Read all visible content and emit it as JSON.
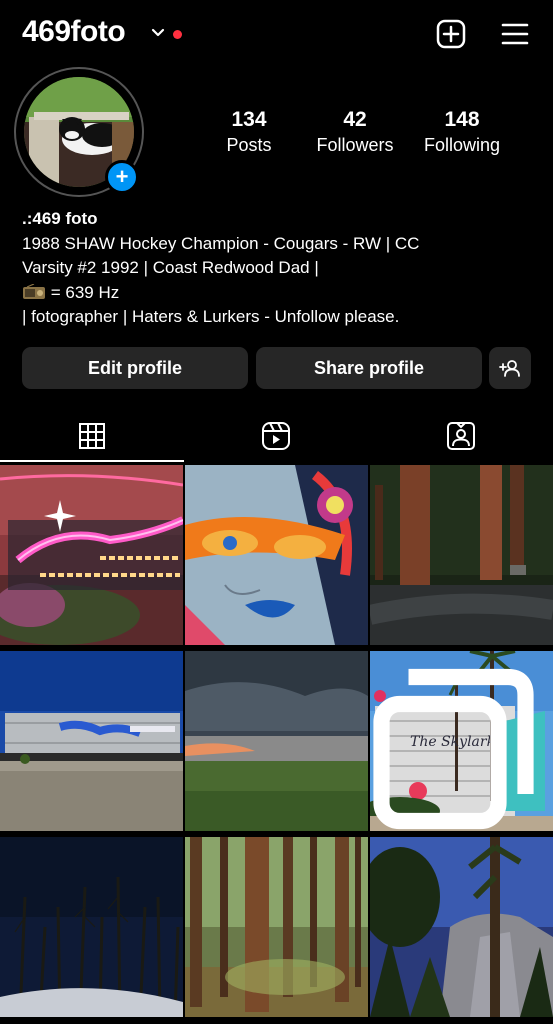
{
  "header": {
    "username": "469foto",
    "icons": [
      "chevron-down-icon",
      "notification-dot",
      "new-post-icon",
      "menu-icon"
    ]
  },
  "stats": {
    "posts": {
      "value": "134",
      "label": "Posts"
    },
    "followers": {
      "value": "42",
      "label": "Followers"
    },
    "following": {
      "value": "148",
      "label": "Following"
    }
  },
  "bio": {
    "name": ".:469 foto",
    "line1": "1988 SHAW Hockey Champion - Cougars - RW  | CC",
    "line2": "Varsity #2 1992 |  Coast Redwood Dad |",
    "line3_text": " = 639 Hz",
    "line4": "| fotographer |  Haters & Lurkers - Unfollow please."
  },
  "buttons": {
    "edit_profile": "Edit profile",
    "share_profile": "Share profile"
  },
  "tabs": [
    "grid-tab",
    "reels-tab",
    "tagged-tab"
  ],
  "posts": [
    {
      "id": 1,
      "subject": "Tropicale neon sign"
    },
    {
      "id": 2,
      "subject": "Mural of face with orange sunglasses"
    },
    {
      "id": 3,
      "subject": "Redwood trunks"
    },
    {
      "id": 4,
      "subject": "Graffiti train car"
    },
    {
      "id": 5,
      "subject": "Cloudy sunset over field"
    },
    {
      "id": 6,
      "subject": "Skylark building with palm trees",
      "multi": true
    },
    {
      "id": 7,
      "subject": "Night sky over burned trees"
    },
    {
      "id": 8,
      "subject": "Sequoia forest"
    },
    {
      "id": 9,
      "subject": "Granite cliff through trees"
    }
  ],
  "colors": {
    "background": "#000000",
    "button": "#262626",
    "accent_blue": "#0095f6",
    "red_dot": "#ff3040"
  }
}
